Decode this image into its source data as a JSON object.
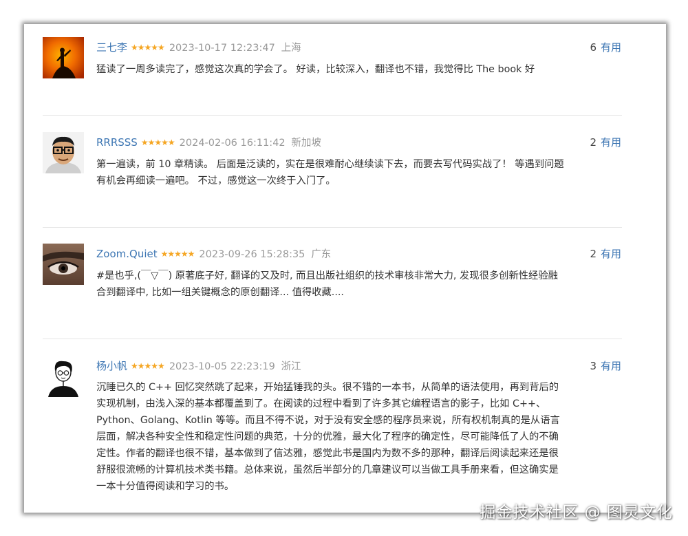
{
  "reviews": [
    {
      "username": "三七李",
      "stars": "★★★★★",
      "date": "2023-10-17 12:23:47",
      "location": "上海",
      "helpful_count": "6",
      "helpful_label": "有用",
      "content": "猛读了一周多读完了，感觉这次真的学会了。 好读，比较深入，翻译也不错，我觉得比 The book 好",
      "avatar": "silhouette-sunset-avatar"
    },
    {
      "username": "RRRSSS",
      "stars": "★★★★★",
      "date": "2024-02-06 16:11:42",
      "location": "新加坡",
      "helpful_count": "2",
      "helpful_label": "有用",
      "content": "第一遍读，前 10 章精读。 后面是泛读的，实在是很难耐心继续读下去，而要去写代码实战了！ 等遇到问题\n有机会再细读一遍吧。 不过，感觉这一次终于入门了。",
      "avatar": "cartoon-glasses-avatar"
    },
    {
      "username": "Zoom.Quiet",
      "stars": "★★★★★",
      "date": "2023-09-26 15:28:35",
      "location": "广东",
      "helpful_count": "2",
      "helpful_label": "有用",
      "content": "#是也乎,(￣▽￣) 原著底子好, 翻译的又及时, 而且出版社组织的技术审核非常大力, 发现很多创新性经验融\n合到翻译中, 比如一组关键概念的原创翻译... 值得收藏....",
      "avatar": "eye-closeup-avatar"
    },
    {
      "username": "杨小帆",
      "stars": "★★★★★",
      "date": "2023-10-05 22:23:19",
      "location": "浙江",
      "helpful_count": "3",
      "helpful_label": "有用",
      "content": "沉睡已久的 C++ 回忆突然跳了起来，开始猛锤我的头。很不错的一本书，从简单的语法使用，再到背后的\n实现机制，由浅入深的基本都覆盖到了。在阅读的过程中看到了许多其它编程语言的影子，比如 C++、\nPython、Golang、Kotlin 等等。而且不得不说，对于没有安全感的程序员来说，所有权机制真的是从语言\n层面，解决各种安全性和稳定性问题的典范，十分的优雅，最大化了程序的确定性，尽可能降低了人的不确\n定性。作者的翻译也很不错，基本做到了信达雅，感觉此书是国内为数不多的那种，翻译后阅读起来还是很\n舒服很流畅的计算机技术类书籍。总体来说，虽然后半部分的几章建议可以当做工具手册来看，但这确实是\n一本十分值得阅读和学习的书。",
      "avatar": "sketch-person-avatar"
    }
  ],
  "watermark": "掘金技术社区 @ 图灵文化",
  "colors": {
    "username": "#3d76b3",
    "star": "#f5a623",
    "meta": "#999999",
    "text": "#333333"
  }
}
